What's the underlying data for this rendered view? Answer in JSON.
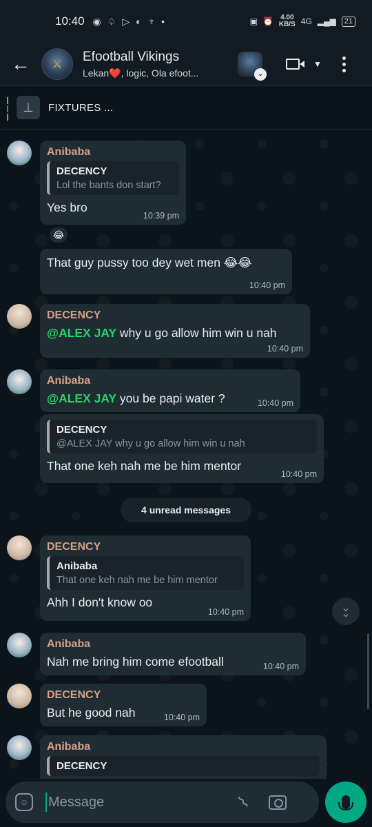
{
  "status_bar": {
    "time": "10:40",
    "speed_value": "4.00",
    "speed_unit": "KB/S",
    "network": "4G",
    "battery": "21"
  },
  "header": {
    "title": "Efootball Vikings",
    "subtitle": "Lekan❤️, logic, Ola efoot..."
  },
  "pinned": {
    "text": "FIXTURES ..."
  },
  "messages": [
    {
      "sender": "Anibaba",
      "quote_name": "DECENCY",
      "quote_text": "Lol the bants don start?",
      "text": "Yes bro",
      "time": "10:39 pm",
      "reaction": "😂"
    },
    {
      "text": "That guy pussy too dey wet men 😂😂",
      "time": "10:40 pm"
    },
    {
      "sender": "DECENCY",
      "mention": "@ALEX JAY",
      "text": " why u go allow him win u nah",
      "time": "10:40 pm"
    },
    {
      "sender": "Anibaba",
      "mention": "@ALEX JAY",
      "text": " you be papi water ?",
      "time": "10:40 pm"
    },
    {
      "quote_name": "DECENCY",
      "quote_text": "@ALEX JAY why u go allow him win u nah",
      "text": "That one keh nah me be him mentor",
      "time": "10:40 pm"
    },
    {
      "sender": "DECENCY",
      "quote_name": "Anibaba",
      "quote_text": "That one keh nah me be him mentor",
      "text": "Ahh I don't know oo",
      "time": "10:40 pm"
    },
    {
      "sender": "Anibaba",
      "text": "Nah me bring him come efootball",
      "time": "10:40 pm"
    },
    {
      "sender": "DECENCY",
      "text": "But he good nah",
      "time": "10:40 pm"
    },
    {
      "sender": "Anibaba",
      "quote_name": "DECENCY"
    }
  ],
  "unread_divider": "4 unread messages",
  "input": {
    "placeholder": "Message"
  },
  "colors": {
    "accent": "#00a884",
    "mention": "#25d366",
    "sender_name": "#d6a286",
    "bubble": "#202c33",
    "background": "#0b141a"
  },
  "icons": {
    "back": "arrow-left-icon",
    "video": "video-camera-icon",
    "menu": "more-vertical-icon",
    "pin": "pin-icon",
    "emoji": "sticker-icon",
    "attach": "paperclip-icon",
    "camera": "camera-icon",
    "mic": "microphone-icon",
    "scroll": "double-chevron-down-icon"
  }
}
